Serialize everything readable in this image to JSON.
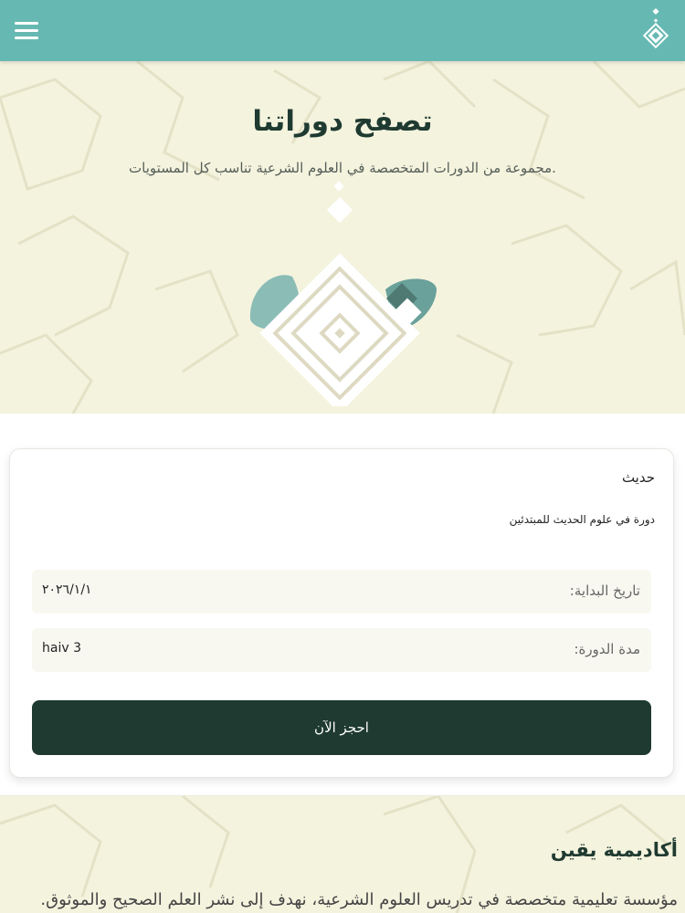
{
  "header": {
    "menu_icon": "hamburger-menu-icon",
    "logo_icon": "yaqeen-logo-icon",
    "bar_color": "#66b9b2"
  },
  "hero": {
    "title": "تصفح دوراتنا",
    "subtitle": "مجموعة من الدورات المتخصصة في العلوم الشرعية تناسب كل المستويات.",
    "background_color": "#f4f3de"
  },
  "course_card": {
    "title": "حديث",
    "description": "دورة في علوم الحديث للمبتدئين",
    "start_date_label": "تاريخ البداية:",
    "start_date_value": "٢٠٢٦/١/١",
    "duration_label": "مدة الدورة:",
    "duration_value": "haiv 3",
    "book_button": "احجز الآن"
  },
  "about": {
    "title": "أكاديمية يقين",
    "text": "مؤسسة تعليمية متخصصة في تدريس العلوم الشرعية، نهدف إلى نشر العلم الصحيح والموثوق."
  },
  "colors": {
    "primary_dark": "#1f3a30",
    "teal": "#66b9b2",
    "cream": "#f4f3de"
  }
}
